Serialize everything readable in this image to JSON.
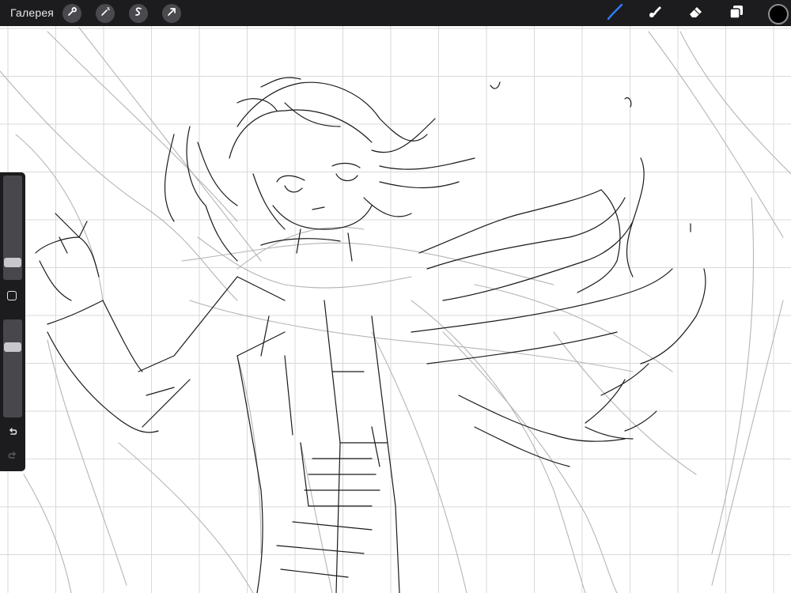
{
  "app": {
    "gallery_label": "Галерея"
  },
  "toolbar": {
    "actions": [
      "wrench-icon",
      "magic-wand-icon",
      "selection-icon",
      "transform-arrow-icon"
    ],
    "tools": [
      "brush-icon",
      "smudge-icon",
      "eraser-icon",
      "layers-icon"
    ],
    "active_tool": "brush",
    "active_tool_color": "#2f7df6",
    "current_color": "#000000"
  },
  "sidebar": {
    "brush_size_level": 0.13,
    "opacity_level": 0.74
  },
  "canvas": {
    "background": "#ffffff",
    "grid_color": "#d9d9d9"
  }
}
